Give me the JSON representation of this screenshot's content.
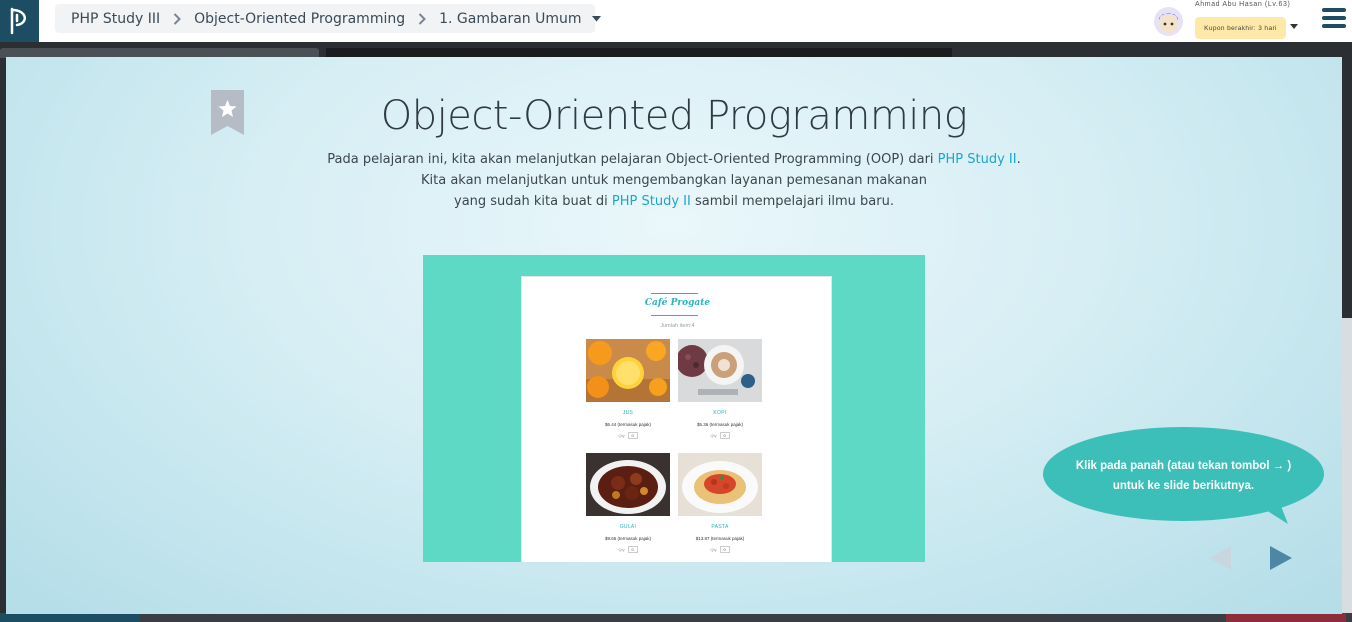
{
  "header": {
    "breadcrumb": [
      "PHP Study III",
      "Object-Oriented Programming",
      "1. Gambaran Umum"
    ],
    "user_name": "Ahmad Abu Hasan (Lv.63)",
    "coupon_text": "Kupon berakhir: 3 hari"
  },
  "slide": {
    "title": "Object-Oriented Programming",
    "desc": {
      "l1_before": "Pada pelajaran ini, kita akan melanjutkan pelajaran Object-Oriented Programming (OOP) dari ",
      "l1_link": "PHP Study II",
      "l1_after": ".",
      "l2": "Kita akan melanjutkan untuk mengembangkan layanan pemesanan makanan",
      "l3_before": "yang sudah kita buat di ",
      "l3_link": "PHP Study II",
      "l3_after": " sambil mempelajari ilmu baru."
    },
    "preview": {
      "brand": "Café Progate",
      "item_count": "Jumlah item:4",
      "qty_label": "Qty",
      "qty_value": "0",
      "items": [
        {
          "name": "JUS",
          "price": "$6.44 (termasuk pajak)"
        },
        {
          "name": "KOPI",
          "price": "$5.36 (termasuk pajak)"
        },
        {
          "name": "GULAI",
          "price": "$9.65 (termasuk pajak)"
        },
        {
          "name": "PASTA",
          "price": "$13.87 (termasuk pajak)"
        }
      ]
    },
    "hint_line1": "Klik pada panah (atau tekan tombol → )",
    "hint_line2": "untuk ke slide berikutnya."
  },
  "colors": {
    "brand_dark": "#1d4d63",
    "accent_teal": "#3bbfb8",
    "link": "#1aa7c9",
    "preview_bg": "#5ed9c6"
  },
  "icons": [
    "progate-logo-icon",
    "chevron-right-icon",
    "caret-down-icon",
    "hamburger-menu-icon",
    "bookmark-star-icon",
    "arrow-left-icon",
    "arrow-right-icon"
  ]
}
